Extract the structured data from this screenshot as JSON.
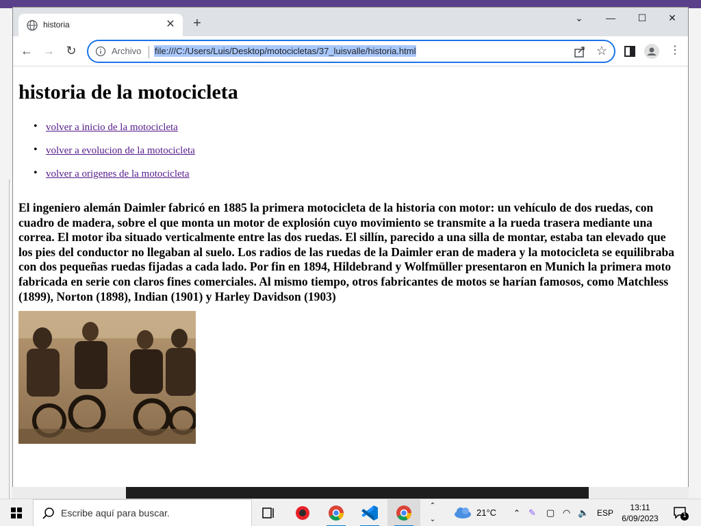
{
  "browser": {
    "tab_title": "historia",
    "new_tab_symbol": "+",
    "scheme_label": "Archivo",
    "url": "file:///C:/Users/Luis/Desktop/motocicletas/37_luisvalle/historia.html"
  },
  "page": {
    "heading": "historia de la motocicleta",
    "links": [
      "volver a inicio de la motocicleta",
      "volver a evolucion de la motocicleta",
      "volver a origenes de la motocicleta"
    ],
    "paragraph": "El ingeniero alemán Daimler fabricó en 1885 la primera motocicleta de la historia con motor: un vehículo de dos ruedas, con cuadro de madera, sobre el que monta un motor de explosión cuyo movimiento se transmite a la rueda trasera mediante una correa. El motor iba situado verticalmente entre las dos ruedas. El sillín, parecido a una silla de montar, estaba tan elevado que los pies del conductor no llegaban al suelo. Los radios de las ruedas de la Daimler eran de madera y la motocicleta se equilibraba con dos pequeñas ruedas fijadas a cada lado. Por fin en 1894, Hildebrand y Wolfmüller presentaron en Munich la primera moto fabricada en serie con claros fines comerciales. Al mismo tiempo, otros fabricantes de motos se harían famosos, como Matchless (1899), Norton (1898), Indian (1901) y Harley Davidson (1903)"
  },
  "taskbar": {
    "search_placeholder": "Escribe aquí para buscar.",
    "temperature": "21°C",
    "language": "ESP",
    "time": "13:11",
    "date": "6/09/2023",
    "notification_count": "1"
  },
  "colors": {
    "accent": "#1a73e8",
    "link_visited": "#551a8b",
    "url_selection": "#a8c7fa"
  }
}
